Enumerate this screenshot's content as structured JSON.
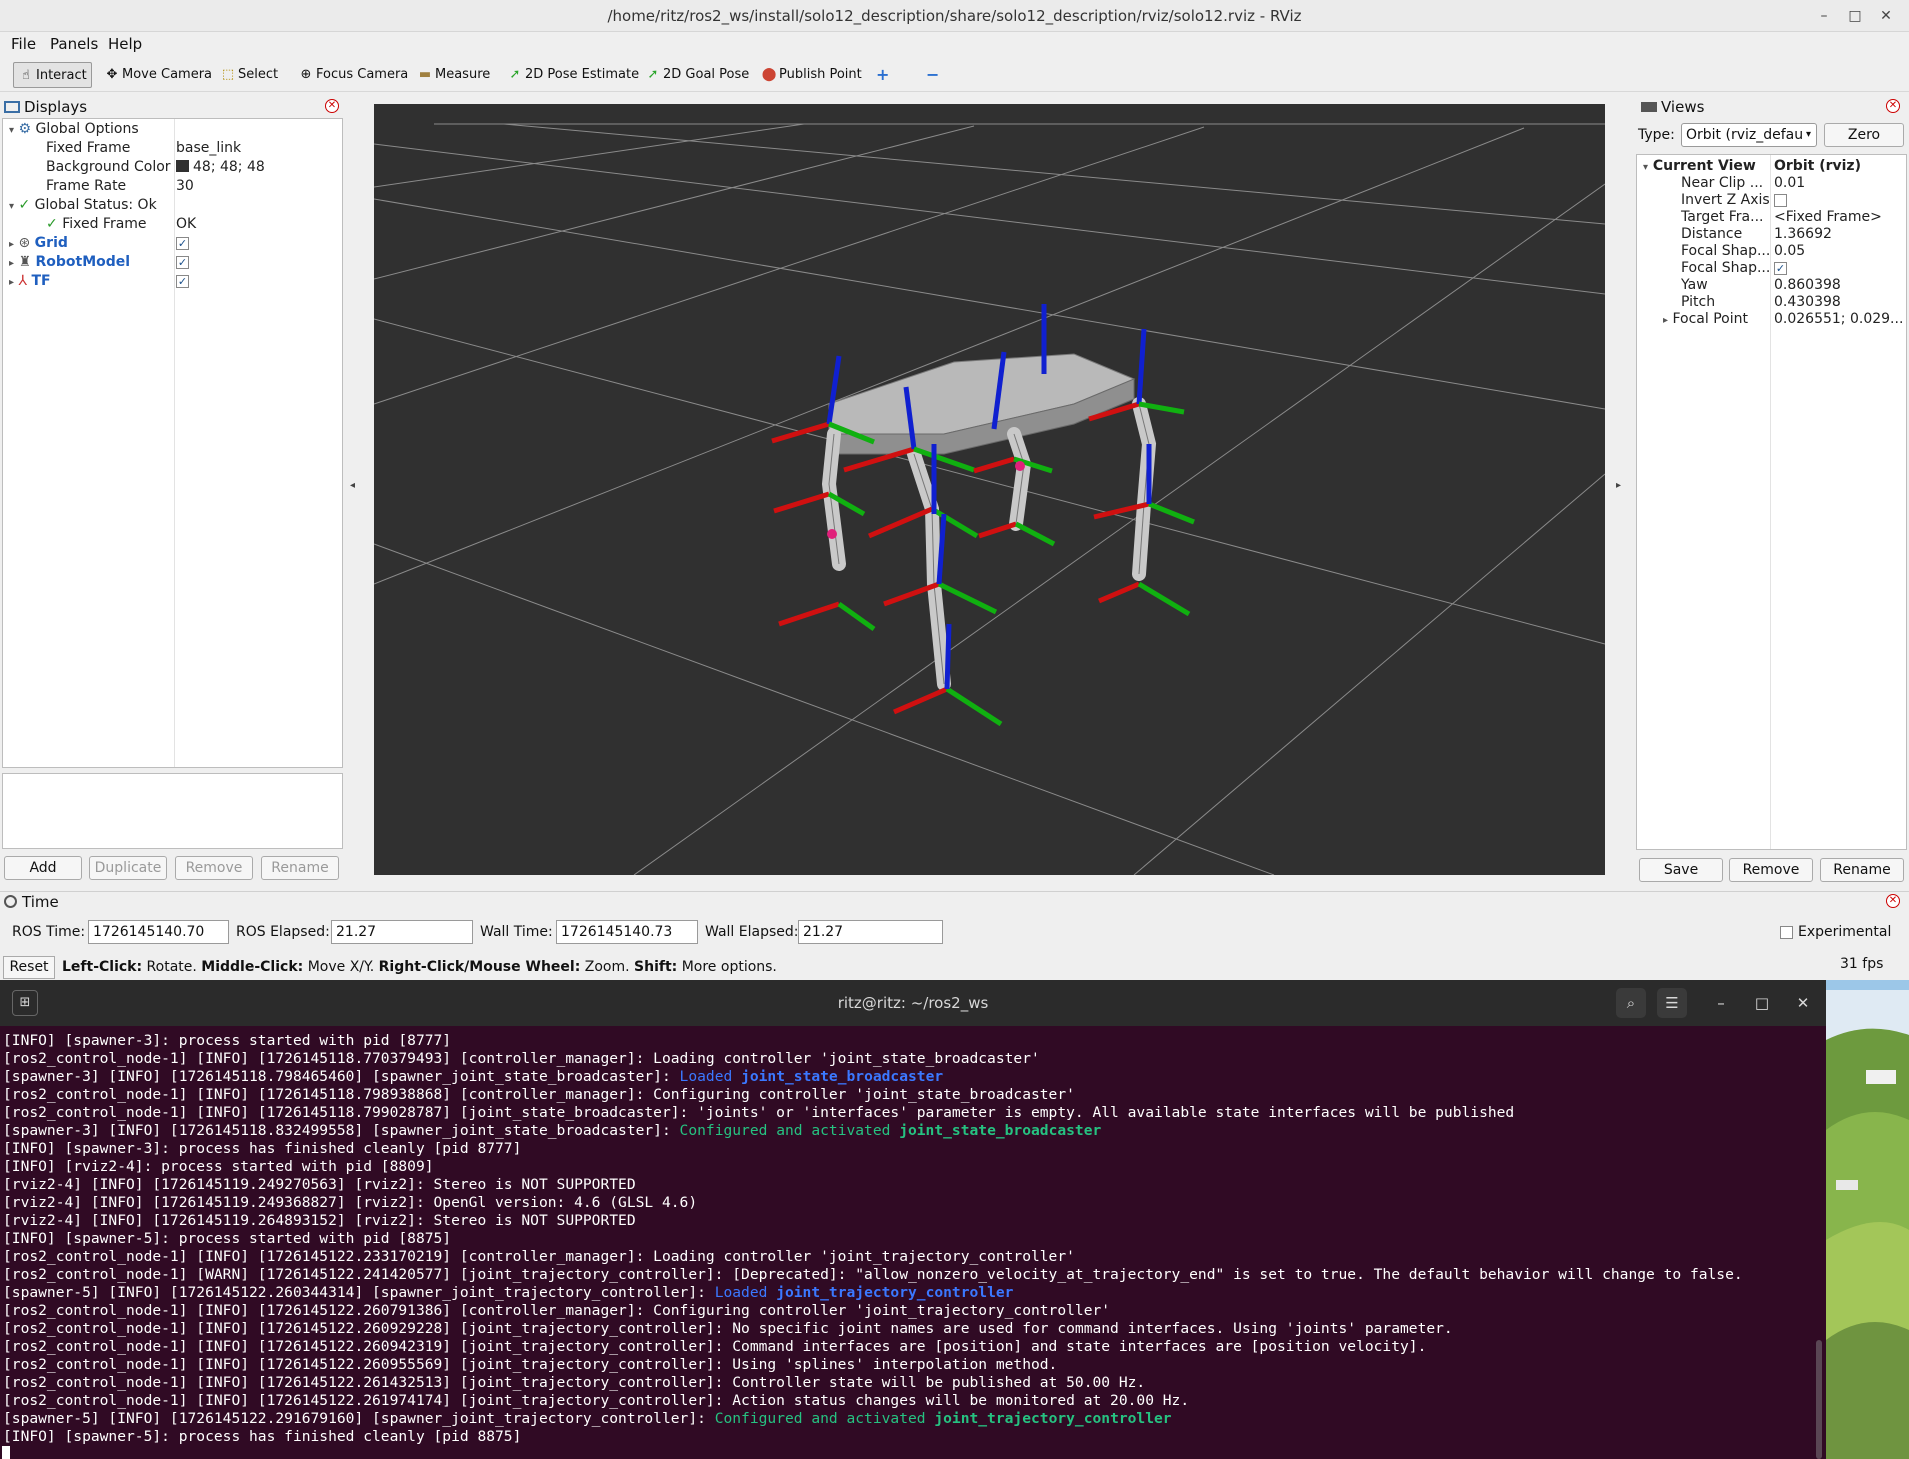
{
  "window": {
    "title": "/home/ritz/ros2_ws/install/solo12_description/share/solo12_description/rviz/solo12.rviz - RViz",
    "minimize": "–",
    "maximize": "□",
    "close": "✕"
  },
  "menu": {
    "file": "File",
    "panels": "Panels",
    "help": "Help"
  },
  "toolbar": {
    "interact": "Interact",
    "move_camera": "Move Camera",
    "select": "Select",
    "focus_camera": "Focus Camera",
    "measure": "Measure",
    "pose_estimate": "2D Pose Estimate",
    "goal_pose": "2D Goal Pose",
    "publish_point": "Publish Point",
    "add_tool": "+",
    "remove_tool": "−"
  },
  "displays": {
    "title": "Displays",
    "global_options": "Global Options",
    "fixed_frame_label": "Fixed Frame",
    "fixed_frame_value": "base_link",
    "bg_color_label": "Background Color",
    "bg_color_value": "48; 48; 48",
    "bg_color_swatch": "#303030",
    "frame_rate_label": "Frame Rate",
    "frame_rate_value": "30",
    "global_status": "Global Status: Ok",
    "status_fixed_frame": "Fixed Frame",
    "status_fixed_frame_value": "OK",
    "grid": "Grid",
    "robot_model": "RobotModel",
    "tf": "TF",
    "add": "Add",
    "duplicate": "Duplicate",
    "remove": "Remove",
    "rename": "Rename"
  },
  "views": {
    "title": "Views",
    "type_label": "Type:",
    "type_value": "Orbit (rviz_defau",
    "zero": "Zero",
    "current_view": "Current View",
    "current_view_value": "Orbit (rviz)",
    "props": [
      {
        "label": "Near Clip ...",
        "value": "0.01"
      },
      {
        "label": "Invert Z Axis",
        "value": ""
      },
      {
        "label": "Target Fra...",
        "value": "<Fixed Frame>"
      },
      {
        "label": "Distance",
        "value": "1.36692"
      },
      {
        "label": "Focal Shap...",
        "value": "0.05"
      },
      {
        "label": "Focal Shap...",
        "value": ""
      },
      {
        "label": "Yaw",
        "value": "0.860398"
      },
      {
        "label": "Pitch",
        "value": "0.430398"
      },
      {
        "label": "Focal Point",
        "value": "0.026551; 0.029..."
      }
    ],
    "save": "Save",
    "remove": "Remove",
    "rename": "Rename"
  },
  "time": {
    "title": "Time",
    "ros_time_label": "ROS Time:",
    "ros_time": "1726145140.70",
    "ros_elapsed_label": "ROS Elapsed:",
    "ros_elapsed": "21.27",
    "wall_time_label": "Wall Time:",
    "wall_time": "1726145140.73",
    "wall_elapsed_label": "Wall Elapsed:",
    "wall_elapsed": "21.27",
    "experimental": "Experimental"
  },
  "statusbar": {
    "reset": "Reset",
    "hint_b1": "Left-Click:",
    "hint_t1": " Rotate. ",
    "hint_b2": "Middle-Click:",
    "hint_t2": " Move X/Y. ",
    "hint_b3": "Right-Click/Mouse Wheel:",
    "hint_t3": " Zoom. ",
    "hint_b4": "Shift:",
    "hint_t4": " More options.",
    "fps": "31 fps"
  },
  "terminal": {
    "title": "ritz@ritz: ~/ros2_ws",
    "lines": [
      {
        "text": "[INFO] [spawner-3]: process started with pid [8777]"
      },
      {
        "text": "[ros2_control_node-1] [INFO] [1726145118.770379493] [controller_manager]: Loading controller 'joint_state_broadcaster'"
      },
      {
        "text": "[spawner-3] [INFO] [1726145118.798465460] [spawner_joint_state_broadcaster]: ",
        "hl1": "Loaded ",
        "hl1c": "hb",
        "hl2": "joint_state_broadcaster",
        "hl2c": "hbb"
      },
      {
        "text": "[ros2_control_node-1] [INFO] [1726145118.798938868] [controller_manager]: Configuring controller 'joint_state_broadcaster'"
      },
      {
        "text": "[ros2_control_node-1] [INFO] [1726145118.799028787] [joint_state_broadcaster]: 'joints' or 'interfaces' parameter is empty. All available state interfaces will be published"
      },
      {
        "text": "[spawner-3] [INFO] [1726145118.832499558] [spawner_joint_state_broadcaster]: ",
        "hl1": "Configured and activated ",
        "hl1c": "hg",
        "hl2": "joint_state_broadcaster",
        "hl2c": "hgb"
      },
      {
        "text": "[INFO] [spawner-3]: process has finished cleanly [pid 8777]"
      },
      {
        "text": "[INFO] [rviz2-4]: process started with pid [8809]"
      },
      {
        "text": "[rviz2-4] [INFO] [1726145119.249270563] [rviz2]: Stereo is NOT SUPPORTED"
      },
      {
        "text": "[rviz2-4] [INFO] [1726145119.249368827] [rviz2]: OpenGl version: 4.6 (GLSL 4.6)"
      },
      {
        "text": "[rviz2-4] [INFO] [1726145119.264893152] [rviz2]: Stereo is NOT SUPPORTED"
      },
      {
        "text": "[INFO] [spawner-5]: process started with pid [8875]"
      },
      {
        "text": "[ros2_control_node-1] [INFO] [1726145122.233170219] [controller_manager]: Loading controller 'joint_trajectory_controller'"
      },
      {
        "text": "[ros2_control_node-1] [WARN] [1726145122.241420577] [joint_trajectory_controller]: [Deprecated]: \"allow_nonzero_velocity_at_trajectory_end\" is set to true. The default behavior will change to false."
      },
      {
        "text": "[spawner-5] [INFO] [1726145122.260344314] [spawner_joint_trajectory_controller]: ",
        "hl1": "Loaded ",
        "hl1c": "hb",
        "hl2": "joint_trajectory_controller",
        "hl2c": "hbb"
      },
      {
        "text": "[ros2_control_node-1] [INFO] [1726145122.260791386] [controller_manager]: Configuring controller 'joint_trajectory_controller'"
      },
      {
        "text": "[ros2_control_node-1] [INFO] [1726145122.260929228] [joint_trajectory_controller]: No specific joint names are used for command interfaces. Using 'joints' parameter."
      },
      {
        "text": "[ros2_control_node-1] [INFO] [1726145122.260942319] [joint_trajectory_controller]: Command interfaces are [position] and state interfaces are [position velocity]."
      },
      {
        "text": "[ros2_control_node-1] [INFO] [1726145122.260955569] [joint_trajectory_controller]: Using 'splines' interpolation method."
      },
      {
        "text": "[ros2_control_node-1] [INFO] [1726145122.261432513] [joint_trajectory_controller]: Controller state will be published at 50.00 Hz."
      },
      {
        "text": "[ros2_control_node-1] [INFO] [1726145122.261974174] [joint_trajectory_controller]: Action status changes will be monitored at 20.00 Hz."
      },
      {
        "text": "[spawner-5] [INFO] [1726145122.291679160] [spawner_joint_trajectory_controller]: ",
        "hl1": "Configured and activated ",
        "hl1c": "hg",
        "hl2": "joint_trajectory_controller",
        "hl2c": "hgb"
      },
      {
        "text": "[INFO] [spawner-5]: process has finished cleanly [pid 8875]"
      }
    ]
  },
  "colors": {
    "viewport_bg": "#303030",
    "terminal_bg": "#300a24",
    "axis_x": "#d01010",
    "axis_y": "#10b010",
    "axis_z": "#1020d0"
  }
}
